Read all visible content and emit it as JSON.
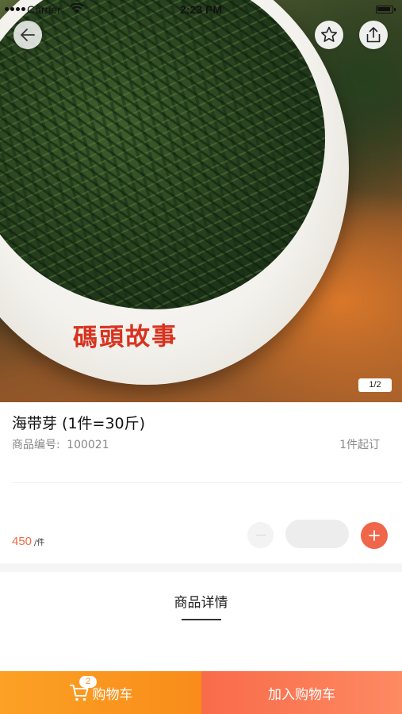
{
  "status_bar": {
    "carrier": "Carrier",
    "time": "2:23 PM"
  },
  "gallery": {
    "image_brand_text": "碼頭故事",
    "page_indicator": "1/2"
  },
  "product": {
    "title": "海带芽 (1件=30斤)",
    "code_label": "商品编号:",
    "code": "100021",
    "min_order": "1件起订",
    "price": "450",
    "price_unit": "/件",
    "quantity": ""
  },
  "tabs": {
    "details": "商品详情"
  },
  "bottom_bar": {
    "cart_label": "购物车",
    "cart_count": "2",
    "add_to_cart": "加入购物车"
  },
  "icons": {
    "back": "arrow-left-icon",
    "favorite": "star-icon",
    "share": "share-icon",
    "cart": "cart-icon",
    "minus": "minus-icon",
    "plus": "plus-icon"
  },
  "colors": {
    "accent": "#f0664a",
    "price": "#ef6a46",
    "cart_button": "#f98c1b",
    "add_button": "#f96b4a"
  }
}
